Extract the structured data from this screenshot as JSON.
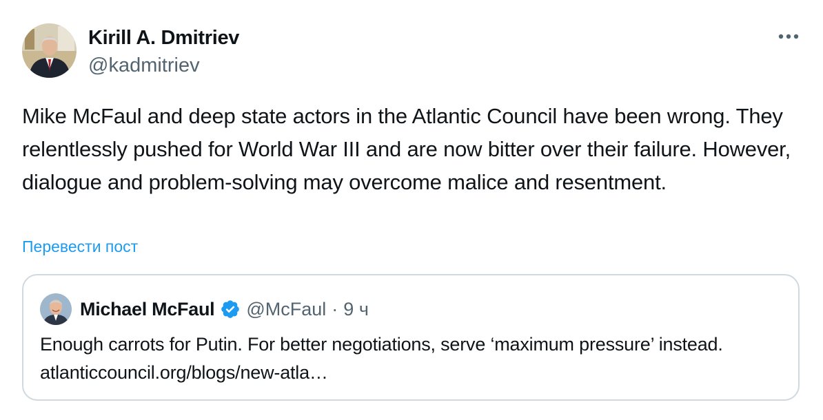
{
  "author": {
    "name": "Kirill A. Dmitriev",
    "handle": "@kadmitriev",
    "avatar_icon": "profile-photo-man-in-suit"
  },
  "more_icon": "more-horizontal-icon",
  "tweet": {
    "text": "Mike McFaul and deep state actors in the Atlantic Council have been wrong. They relentlessly pushed for World War III and are now bitter over their failure. However, dialogue and problem-solving may overcome malice and resentment.",
    "translate_label": "Перевести пост"
  },
  "quoted_tweet": {
    "author_name": "Michael McFaul",
    "verified": true,
    "handle": "@McFaul",
    "separator": "·",
    "time": "9 ч",
    "text": "Enough carrots for Putin. For better negotiations, serve ‘maximum pressure’ instead. atlanticcouncil.org/blogs/new-atla…",
    "avatar_icon": "profile-photo-man-smiling"
  },
  "colors": {
    "text": "#0f1419",
    "secondary_text": "#536471",
    "link": "#1d9bf0",
    "border": "#cfd9de",
    "verified_badge": "#1d9bf0"
  }
}
